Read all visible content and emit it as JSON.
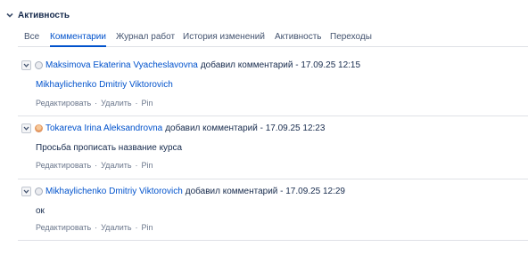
{
  "section": {
    "title": "Активность",
    "expanded": true
  },
  "tabs": [
    {
      "label": "Все",
      "active": false
    },
    {
      "label": "Комментарии",
      "active": true
    },
    {
      "label": "Журнал работ",
      "active": false
    },
    {
      "label": "История изменений",
      "active": false
    },
    {
      "label": "Активность",
      "active": false
    },
    {
      "label": "Переходы",
      "active": false
    }
  ],
  "comments": [
    {
      "author": "Maksimova Ekaterina Vyacheslavovna",
      "action": "добавил комментарий - 17.09.25 12:15",
      "body": "Mikhaylichenko Dmitriy Viktorovich",
      "body_is_link": true,
      "avatar": "default-avatar"
    },
    {
      "author": "Tokareva Irina Aleksandrovna",
      "action": "добавил комментарий - 17.09.25 12:23",
      "body": "Просьба прописать название курса",
      "body_is_link": false,
      "avatar": "photo-avatar"
    },
    {
      "author": "Mikhaylichenko Dmitriy Viktorovich",
      "action": "добавил комментарий - 17.09.25 12:29",
      "body": "ок",
      "body_is_link": false,
      "avatar": "default-avatar"
    }
  ],
  "actions": {
    "edit": "Редактировать",
    "delete": "Удалить",
    "pin": "Pin",
    "separator": "·"
  },
  "colors": {
    "link": "#0052cc",
    "text": "#172b4d",
    "muted": "#6b778c",
    "divider": "#dfe1e6"
  }
}
